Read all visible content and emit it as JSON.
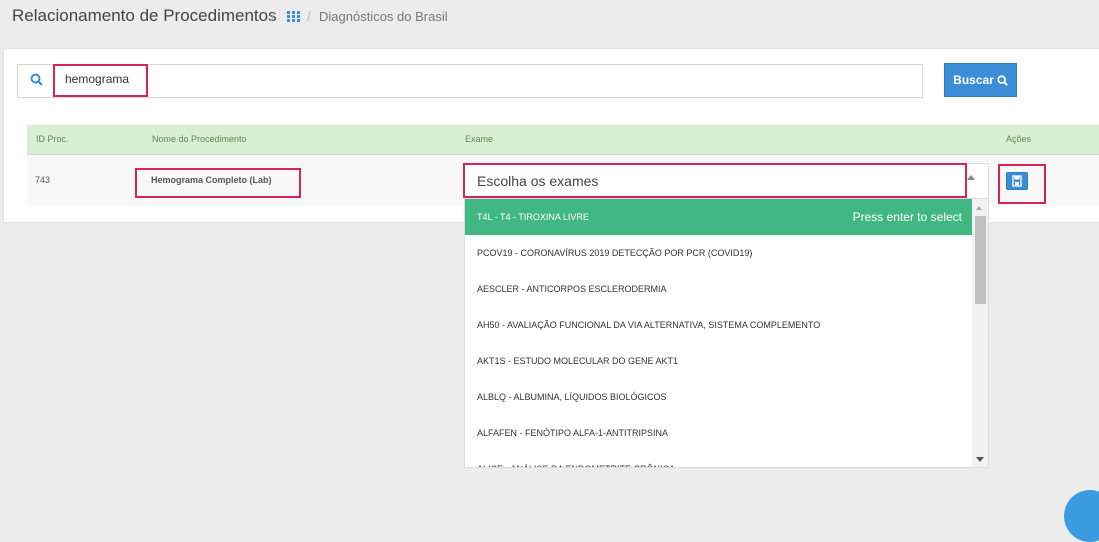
{
  "header": {
    "title": "Relacionamento de Procedimentos",
    "separator": "/",
    "breadcrumb_icon": "grid-icon",
    "breadcrumb_current": "Diagnósticos do Brasil"
  },
  "search": {
    "value": "hemograma",
    "icon": "search-icon",
    "button_label": "Buscar"
  },
  "table": {
    "headers": [
      "ID Proc.",
      "Nome do Procedimento",
      "Exame",
      "Ações"
    ],
    "rows": [
      {
        "id": "743",
        "name": "Hemograma Completo (Lab)",
        "exam_placeholder": "Escolha os exames",
        "action_icon": "save-icon"
      }
    ]
  },
  "dropdown": {
    "hint": "Press enter to select",
    "options": [
      "T4L - T4 - TIROXINA LIVRE",
      "PCOV19 - CORONAVÍRUS 2019 DETECÇÃO POR PCR (COVID19)",
      "AESCLER - ANTICORPOS ESCLERODERMIA",
      "AH50 - AVALIAÇÃO FUNCIONAL DA VIA ALTERNATIVA, SISTEMA COMPLEMENTO",
      "AKT1S - ESTUDO MOLECULAR DO GENE AKT1",
      "ALBLQ - ALBUMINA, LÍQUIDOS BIOLÓGICOS",
      "ALFAFEN - FENÓTIPO ALFA-1-ANTITRIPSINA",
      "ALICE - ANÁLISE DA ENDOMETRITE CRÔNICA"
    ]
  },
  "colors": {
    "accent": "#3a8dd6",
    "highlight": "#d6245a",
    "option_active": "#41b883",
    "table_header": "#d9efd4"
  }
}
